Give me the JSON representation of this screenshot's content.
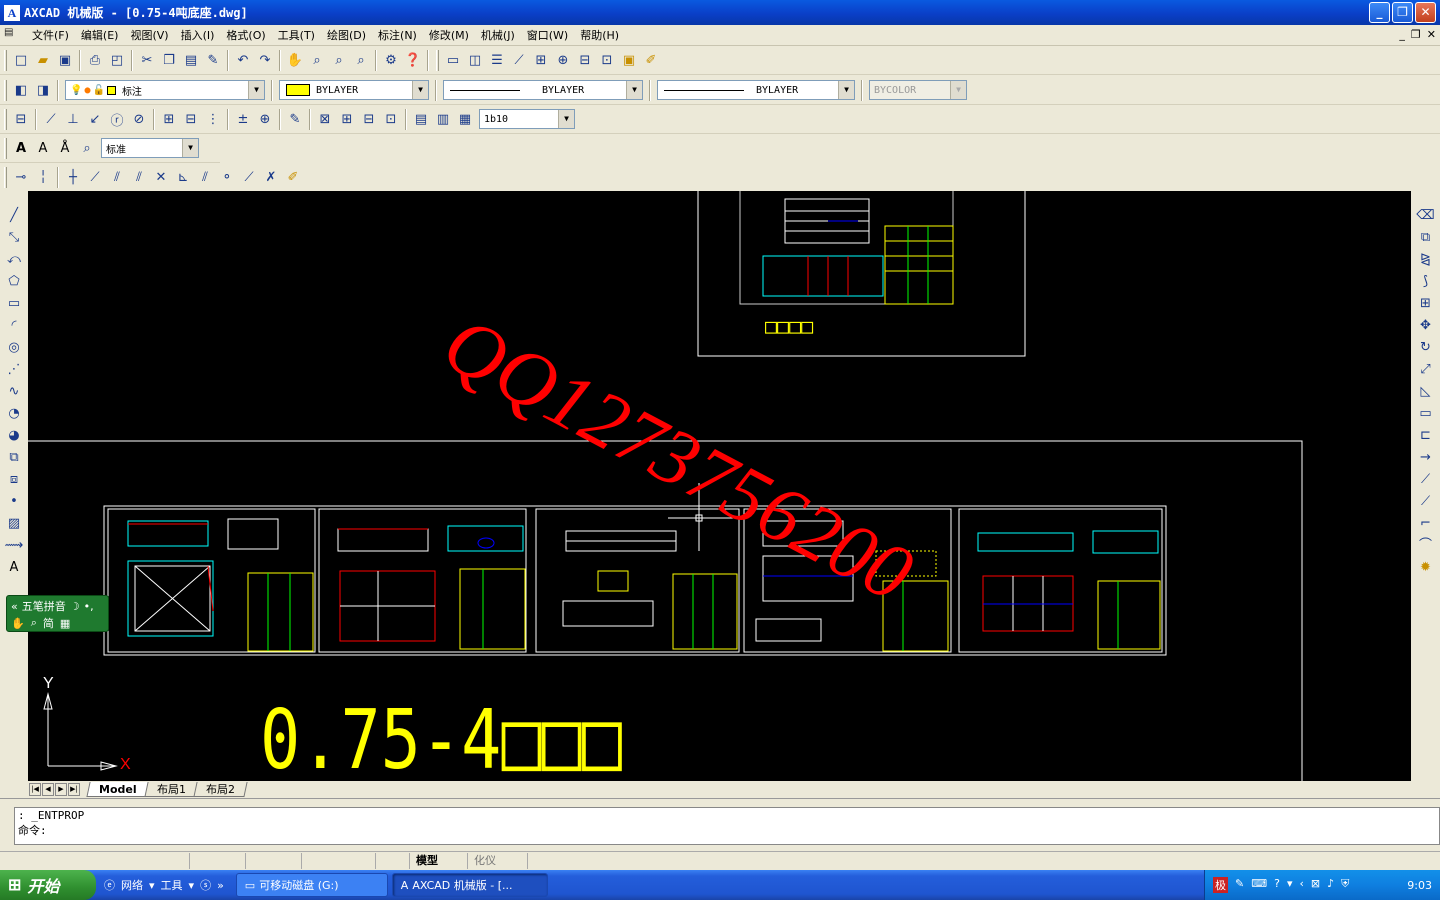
{
  "window": {
    "title": "AXCAD 机械版 - [0.75-4吨底座.dwg]",
    "app_icon": "axcad-logo",
    "buttons": [
      "minimize",
      "maximize",
      "close"
    ]
  },
  "menus": [
    "文件(F)",
    "编辑(E)",
    "视图(V)",
    "插入(I)",
    "格式(O)",
    "工具(T)",
    "绘图(D)",
    "标注(N)",
    "修改(M)",
    "机械(J)",
    "窗口(W)",
    "帮助(H)"
  ],
  "layer_bar": {
    "layer": "标注",
    "color": "BYLAYER",
    "linetype": "BYLAYER",
    "lineweight": "BYLAYER",
    "plotstyle": "BYCOLOR"
  },
  "dim_bar": {
    "dimstyle": "1b10"
  },
  "text_bar": {
    "textstyle": "标准"
  },
  "canvas": {
    "watermark": "QQ1273756200",
    "label_top": "□□□□",
    "label_big": "0.75-4□□□",
    "ucs": {
      "x": "X",
      "y": "Y"
    },
    "colors": {
      "background": "#000000",
      "watermark": "#ff0000",
      "label": "#ffff00",
      "frame": "#ffffff"
    }
  },
  "ime": {
    "name": "五笔拼音",
    "mode": "简"
  },
  "tabs": [
    "Model",
    "布局1",
    "布局2"
  ],
  "command": {
    "line1": ": _ENTPROP",
    "line2": "命令:"
  },
  "status": {
    "model": "模型",
    "thinning": "化仪"
  },
  "taskbar": {
    "start": "开始",
    "quicklaunch": [
      "网络",
      "工具"
    ],
    "tasks": [
      "可移动磁盘 (G:)",
      "AXCAD 机械版 - [..."
    ],
    "clock": "9:03"
  }
}
